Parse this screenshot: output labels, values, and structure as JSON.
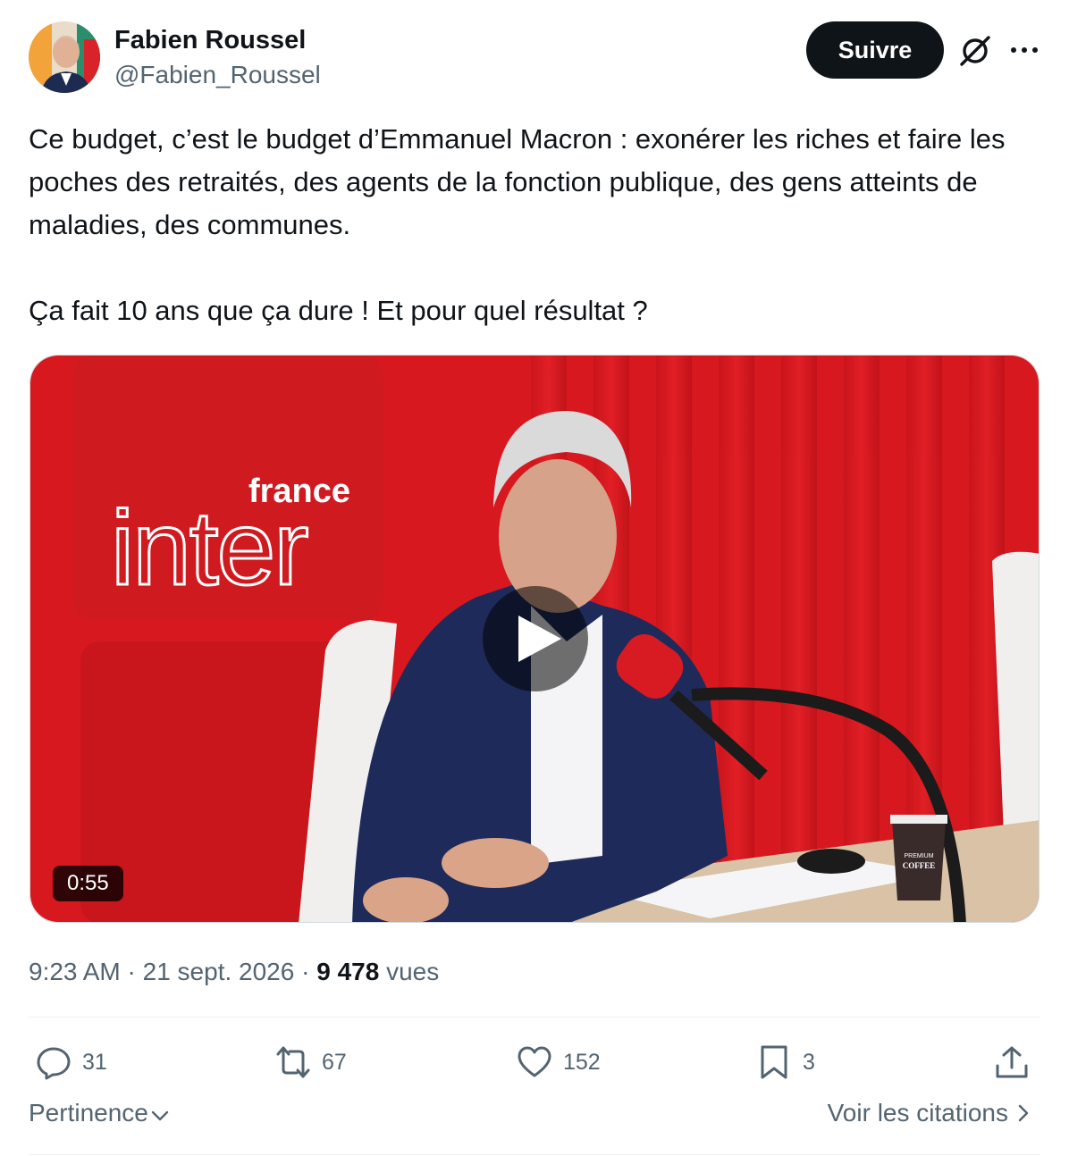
{
  "author": {
    "display_name": "Fabien Roussel",
    "handle": "@Fabien_Roussel"
  },
  "header": {
    "follow_label": "Suivre",
    "icons": [
      "grok-icon",
      "more-icon"
    ]
  },
  "tweet": {
    "paragraphs": [
      "Ce budget, c’est le budget d’Emmanuel Macron : exonérer les riches et faire les poches des retraités, des agents de la fonction publique, des gens atteints de maladies, des communes.",
      "Ça fait 10 ans que ça dure ! Et pour quel résultat ?"
    ]
  },
  "media": {
    "logo_top": "france",
    "logo_bottom": "inter",
    "cup_label_top": "PREMIUM",
    "cup_label_bottom": "COFFEE",
    "duration": "0:55",
    "icons": [
      "play-icon"
    ]
  },
  "meta": {
    "time": "9:23 AM",
    "separator": " · ",
    "date": "21 sept. 2026",
    "views_count": "9 478",
    "views_label": " vues"
  },
  "actions": {
    "replies": "31",
    "reposts": "67",
    "likes": "152",
    "bookmarks": "3",
    "icons": [
      "reply-icon",
      "repost-icon",
      "like-icon",
      "bookmark-icon",
      "share-icon"
    ]
  },
  "footer": {
    "sort_label": "Pertinence",
    "quotes_label": "Voir les citations"
  },
  "colors": {
    "text": "#0f1419",
    "secondary": "#536471",
    "studio_red": "#d8181f",
    "follow_bg": "#0f1419"
  }
}
